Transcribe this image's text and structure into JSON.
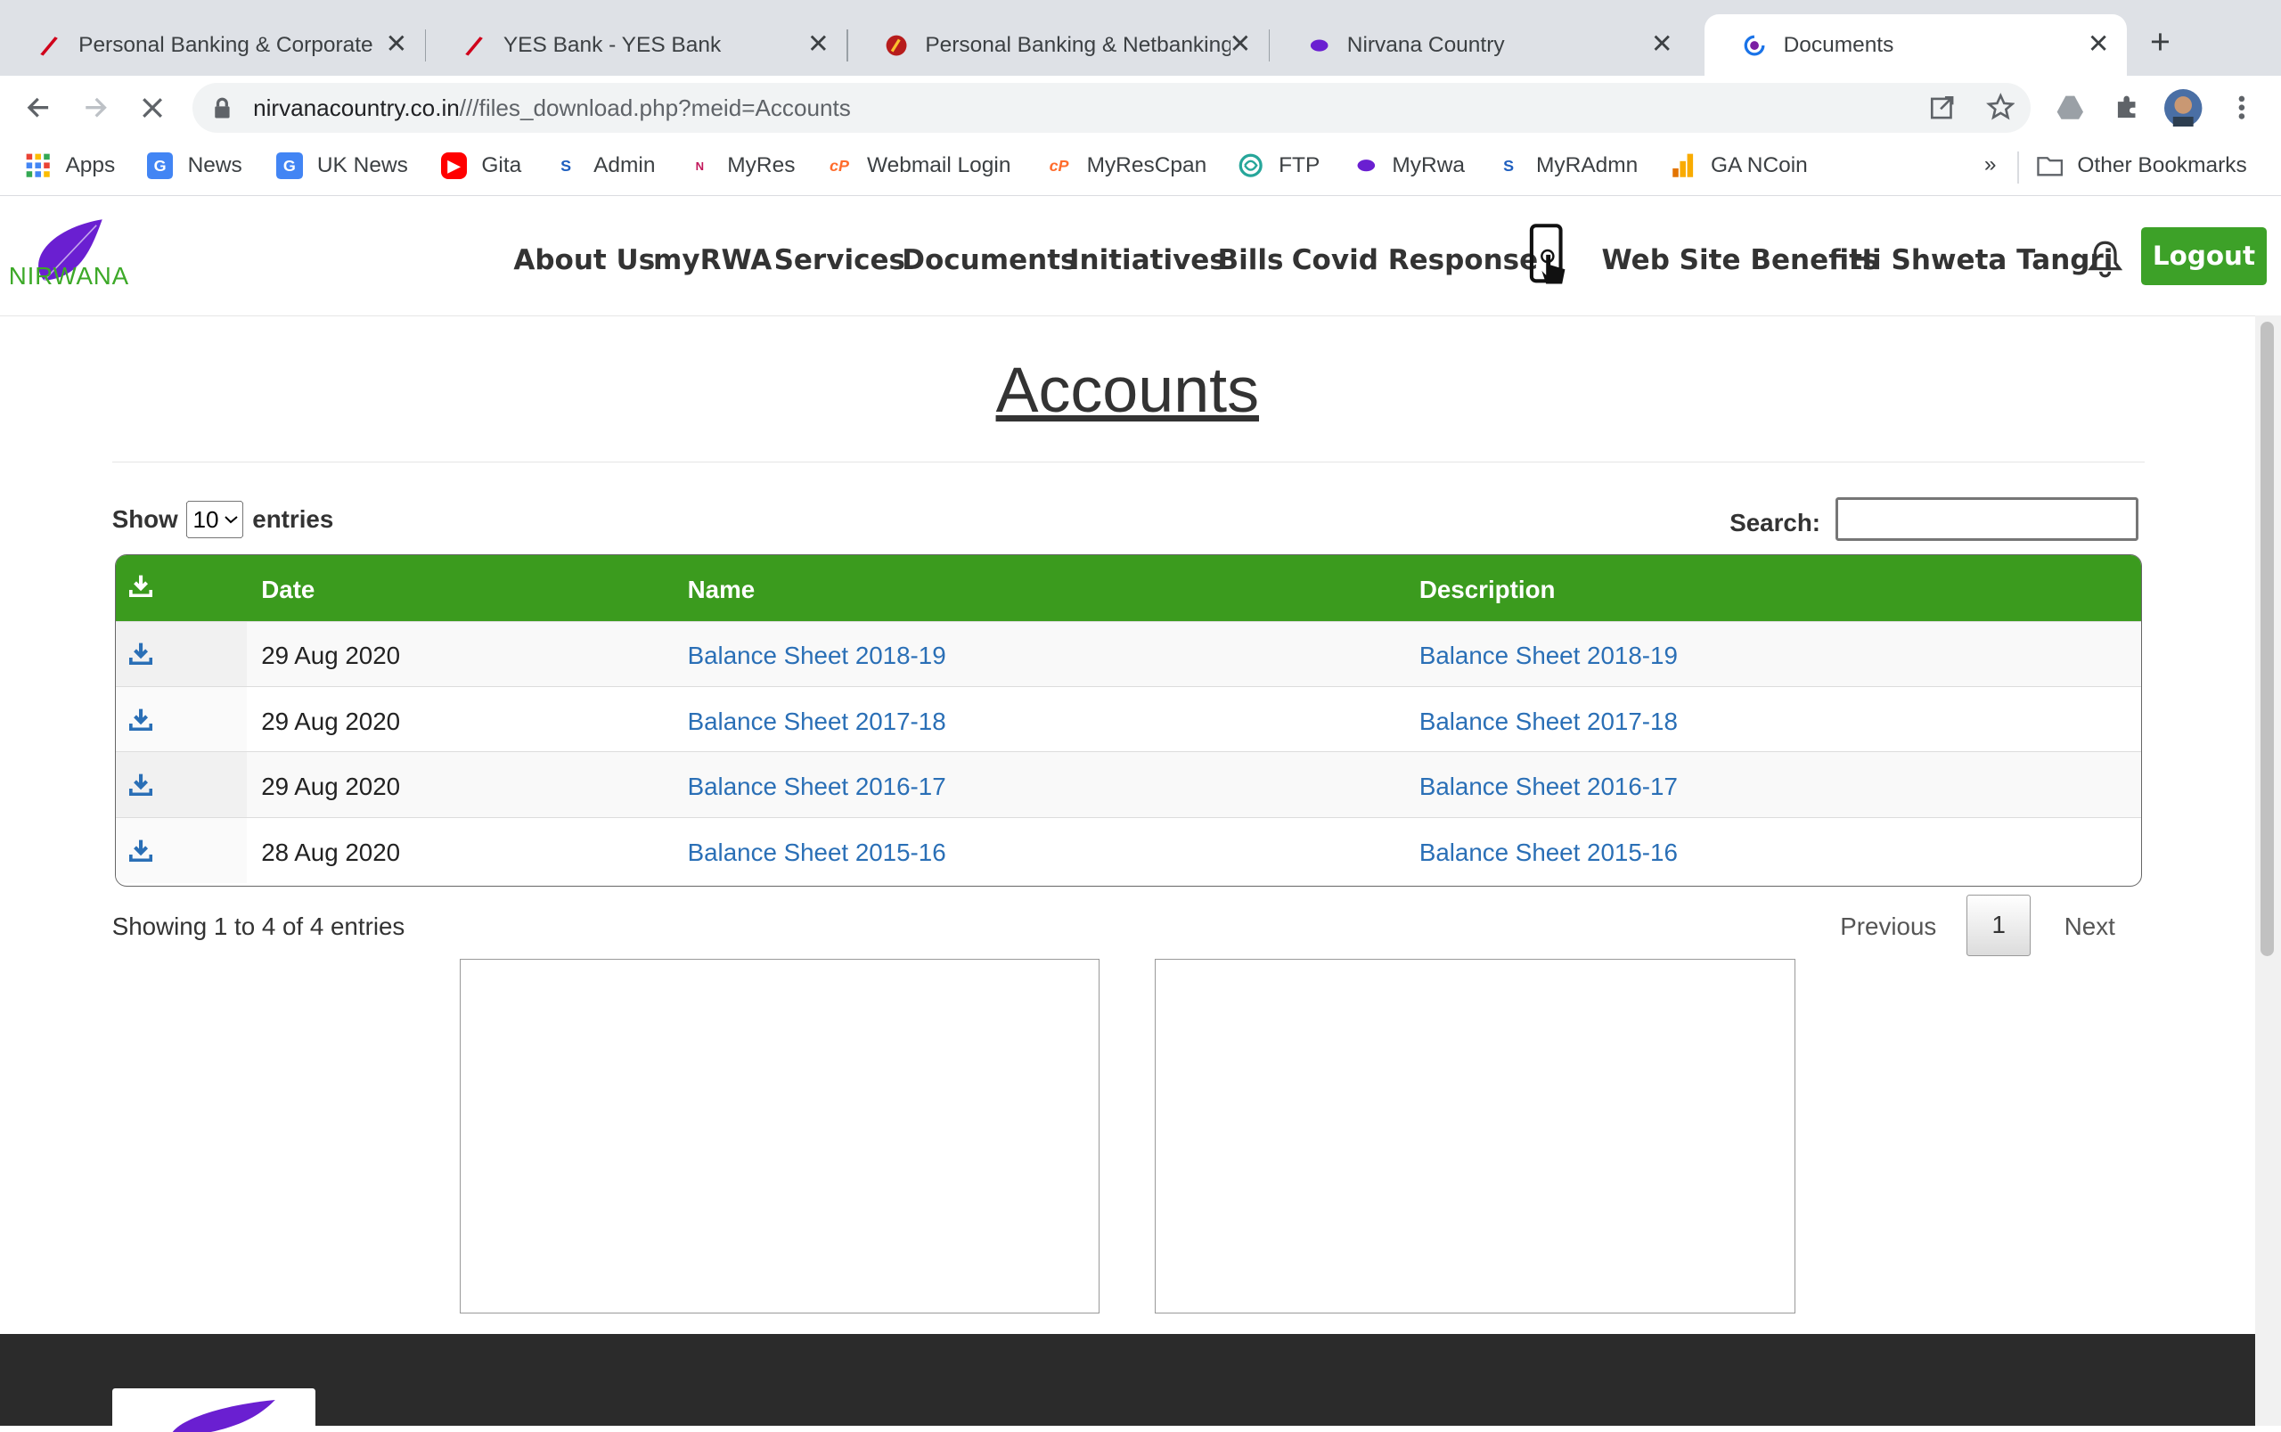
{
  "browser": {
    "tabs": [
      {
        "title": "Personal Banking & Corporate",
        "active": false
      },
      {
        "title": "YES Bank - YES Bank",
        "active": false
      },
      {
        "title": "Personal Banking & Netbanking",
        "active": false
      },
      {
        "title": "Nirvana Country",
        "active": false
      },
      {
        "title": "Documents",
        "active": true
      }
    ],
    "new_tab": "+",
    "close_glyph": "✕",
    "url_host": "nirvanacountry.co.in",
    "url_rest": "///files_download.php?meid=Accounts",
    "bookmarks": [
      "Apps",
      "News",
      "UK News",
      "Gita",
      "Admin",
      "MyRes",
      "Webmail Login",
      "MyResCpan",
      "FTP",
      "MyRwa",
      "MyRAdmn",
      "GA NCoin"
    ],
    "overflow": "»",
    "other_bookmarks": "Other Bookmarks"
  },
  "site": {
    "logo_text": "NIRWANA",
    "nav": [
      "About Us",
      "myRWA",
      "Services",
      "Documents",
      "Initiatives",
      "Bills",
      "Covid Response",
      "Web Site Benefits",
      "Hi Shweta Tangri"
    ],
    "logout": "Logout",
    "accent": "#3b9b1e"
  },
  "main": {
    "title": "Accounts",
    "show_label": "Show",
    "entries_value": "10",
    "entries_label": "entries",
    "search_label": "Search:",
    "columns": [
      "Date",
      "Name",
      "Description"
    ],
    "rows": [
      {
        "date": "29 Aug 2020",
        "name": "Balance Sheet 2018-19",
        "description": "Balance Sheet 2018-19"
      },
      {
        "date": "29 Aug 2020",
        "name": "Balance Sheet 2017-18",
        "description": "Balance Sheet 2017-18"
      },
      {
        "date": "29 Aug 2020",
        "name": "Balance Sheet 2016-17",
        "description": "Balance Sheet 2016-17"
      },
      {
        "date": "28 Aug 2020",
        "name": "Balance Sheet 2015-16",
        "description": "Balance Sheet 2015-16"
      }
    ],
    "info": "Showing 1 to 4 of 4 entries",
    "pager": {
      "previous": "Previous",
      "current": "1",
      "next": "Next"
    }
  }
}
